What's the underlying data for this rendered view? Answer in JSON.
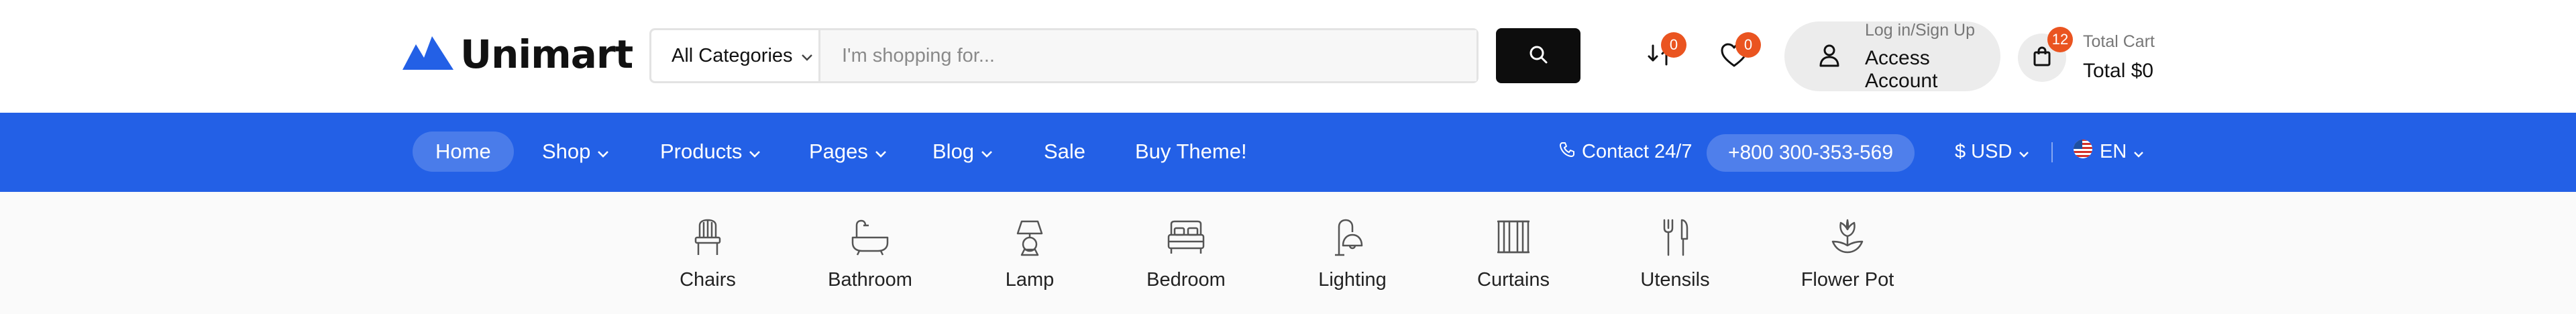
{
  "brand": {
    "name": "Unimart",
    "color": "#2360e6"
  },
  "search": {
    "category": "All Categories",
    "placeholder": "I'm shopping for..."
  },
  "header_actions": {
    "compare_count": "0",
    "wishlist_count": "0",
    "account": {
      "line1": "Log in/Sign Up",
      "line2": "Access Account"
    },
    "cart": {
      "count": "12",
      "label": "Total Cart",
      "total": "Total $0"
    }
  },
  "nav": {
    "items": [
      "Home",
      "Shop",
      "Products",
      "Pages",
      "Blog",
      "Sale",
      "Buy Theme!"
    ],
    "contact_label": "Contact 24/7",
    "phone": "+800 300-353-569",
    "currency": "$ USD",
    "language": "EN"
  },
  "categories": [
    "Chairs",
    "Bathroom",
    "Lamp",
    "Bedroom",
    "Lighting",
    "Curtains",
    "Utensils",
    "Flower Pot"
  ],
  "colors": {
    "nav_bg": "#2360e6",
    "badge": "#ea5420",
    "search_button": "#0d0d0d"
  }
}
